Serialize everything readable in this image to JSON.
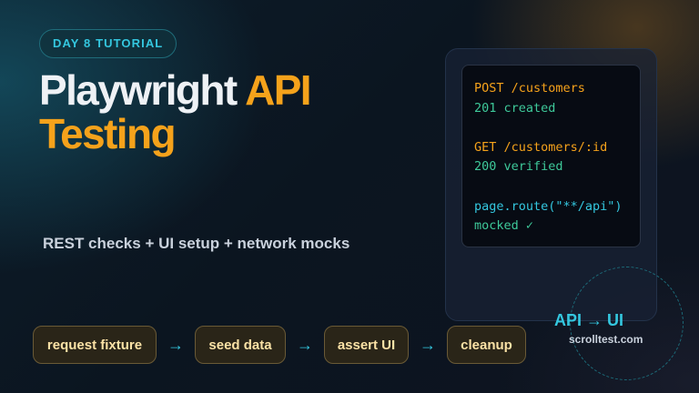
{
  "badge": "DAY 8 TUTORIAL",
  "title": {
    "part1": "Playwright",
    "part2": "API",
    "part3": "Testing"
  },
  "subtitle": "REST checks + UI setup + network mocks",
  "code": {
    "line1": "POST /customers",
    "line2": "201 created",
    "line3": "GET /customers/:id",
    "line4": "200 verified",
    "line5": "page.route(\"**/api\")",
    "line6": "mocked ✓"
  },
  "flow": {
    "step1": "request fixture",
    "step2": "seed data",
    "step3": "assert UI",
    "step4": "cleanup",
    "arrow": "→"
  },
  "api_ui": "API → UI",
  "site": "scrolltest.com",
  "colors": {
    "accent_orange": "#f5a21b",
    "accent_cyan": "#34c7df",
    "accent_green": "#3ec99a"
  }
}
